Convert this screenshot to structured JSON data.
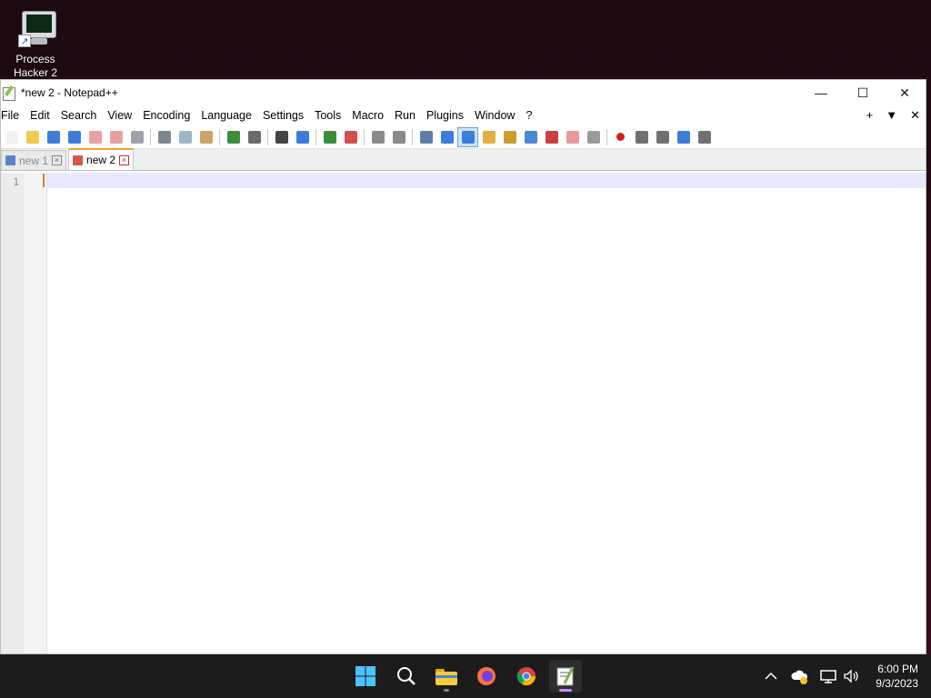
{
  "desktop": {
    "icon_label_line1": "Process",
    "icon_label_line2": "Hacker 2"
  },
  "window": {
    "title": "*new 2 - Notepad++",
    "minimize_glyph": "—",
    "maximize_glyph": "☐",
    "close_glyph": "✕"
  },
  "menu": {
    "items": [
      "File",
      "Edit",
      "Search",
      "View",
      "Encoding",
      "Language",
      "Settings",
      "Tools",
      "Macro",
      "Run",
      "Plugins",
      "Window",
      "?"
    ],
    "right_plus": "+",
    "right_down": "▼",
    "right_close": "✕"
  },
  "toolbar": {
    "buttons": [
      {
        "name": "new-file",
        "color": "#f2f2f2"
      },
      {
        "name": "open-file",
        "color": "#f2c94c"
      },
      {
        "name": "save",
        "color": "#3b7dd8"
      },
      {
        "name": "save-all",
        "color": "#3b7dd8"
      },
      {
        "name": "close",
        "color": "#e8a0a0"
      },
      {
        "name": "close-all",
        "color": "#e8a0a0"
      },
      {
        "name": "print",
        "color": "#9aa3ad"
      },
      {
        "name": "cut",
        "color": "#7b8794"
      },
      {
        "name": "copy",
        "color": "#9fb6cc"
      },
      {
        "name": "paste",
        "color": "#caa56a"
      },
      {
        "name": "undo",
        "color": "#3b8f3b"
      },
      {
        "name": "redo",
        "color": "#6b6b6b"
      },
      {
        "name": "find",
        "color": "#444"
      },
      {
        "name": "replace",
        "color": "#3b7dd8"
      },
      {
        "name": "zoom-in",
        "color": "#3b8f3b"
      },
      {
        "name": "zoom-out",
        "color": "#d05050"
      },
      {
        "name": "sync-v",
        "color": "#8a8a8a"
      },
      {
        "name": "sync-h",
        "color": "#8a8a8a"
      },
      {
        "name": "word-wrap",
        "color": "#5b7fa8"
      },
      {
        "name": "all-chars",
        "color": "#3b7dd8"
      },
      {
        "name": "indent-guide",
        "color": "#3b7dd8"
      },
      {
        "name": "udl",
        "color": "#e0b040"
      },
      {
        "name": "doc-map",
        "color": "#c8a030"
      },
      {
        "name": "doc-list",
        "color": "#4a8ad0"
      },
      {
        "name": "function-list",
        "color": "#c84040"
      },
      {
        "name": "folder-workspace",
        "color": "#e89898"
      },
      {
        "name": "monitoring",
        "color": "#9a9a9a"
      },
      {
        "name": "record-macro",
        "color": "#d02020"
      },
      {
        "name": "stop-macro",
        "color": "#707070"
      },
      {
        "name": "play-macro",
        "color": "#707070"
      },
      {
        "name": "run-macro-multiple",
        "color": "#3b7dd8"
      },
      {
        "name": "save-macro",
        "color": "#707070"
      }
    ]
  },
  "tabs": [
    {
      "label": "new 1",
      "close": "×",
      "active": false
    },
    {
      "label": "new 2",
      "close": "×",
      "active": true
    }
  ],
  "editor": {
    "line_number": "1"
  },
  "taskbar": {
    "time": "6:00 PM",
    "date": "9/3/2023"
  }
}
